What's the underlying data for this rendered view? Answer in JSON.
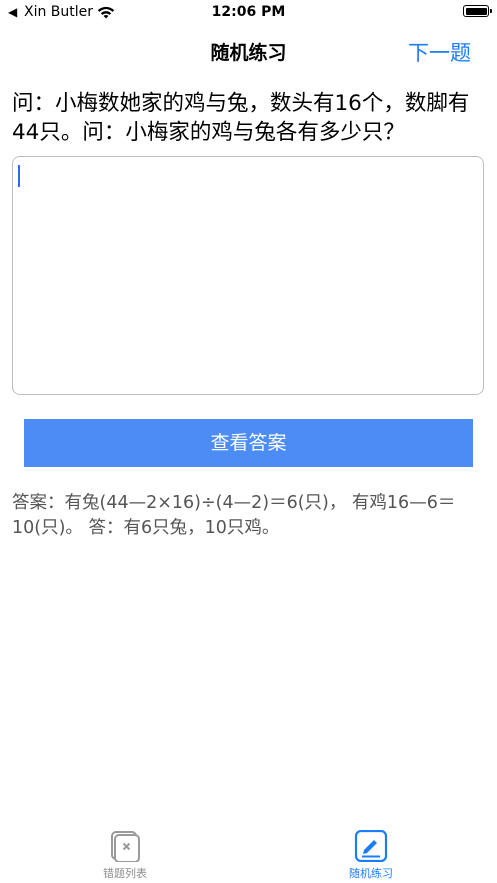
{
  "status_bar": {
    "back_arrow": "◀",
    "carrier": "Xin Butler",
    "time": "12:06 PM",
    "battery_level": 1.0
  },
  "nav": {
    "title": "随机练习",
    "next_button": "下一题"
  },
  "question": "问：小梅数她家的鸡与兔，数头有16个，数脚有44只。问：小梅家的鸡与兔各有多少只？",
  "answer_input": {
    "value": "",
    "placeholder": ""
  },
  "show_answer_button": "查看答案",
  "answer": "答案：有兔(44—2×16)÷(4—2)＝6(只)， 有鸡16—6＝10(只)。 答：有6只兔，10只鸡。",
  "tabs": [
    {
      "label": "错题列表",
      "icon": "wrong-list-icon",
      "active": false
    },
    {
      "label": "随机练习",
      "icon": "practice-icon",
      "active": true
    }
  ],
  "colors": {
    "accent": "#1a7dfa",
    "button": "#4c8cf5",
    "inactive_tab": "#8e8e8e",
    "answer_text": "#555555"
  }
}
